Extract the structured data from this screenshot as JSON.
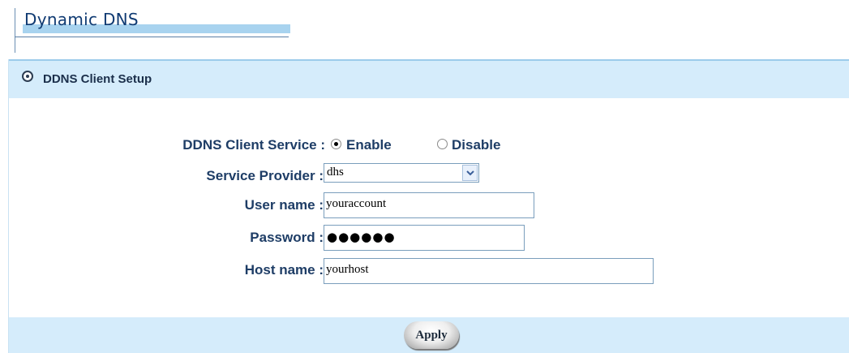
{
  "page": {
    "title": "Dynamic DNS"
  },
  "panel": {
    "header": "DDNS Client Setup"
  },
  "form": {
    "service_label": "DDNS Client Service :",
    "enable_label": "Enable",
    "disable_label": "Disable",
    "service_selected": "Enable",
    "provider_label": "Service Provider :",
    "provider_value": "dhs",
    "username_label": "User name :",
    "username_value": "youraccount",
    "password_label": "Password :",
    "password_mask": "●●●●●●",
    "hostname_label": "Host name :",
    "hostname_value": "yourhost"
  },
  "footer": {
    "apply_label": "Apply"
  },
  "colors": {
    "header_bg": "#d5ecfb",
    "label_text": "#1e3d66",
    "title_text": "#0f3a72"
  },
  "icons": {
    "header": "target-icon",
    "dropdown": "chevron-down-icon"
  }
}
